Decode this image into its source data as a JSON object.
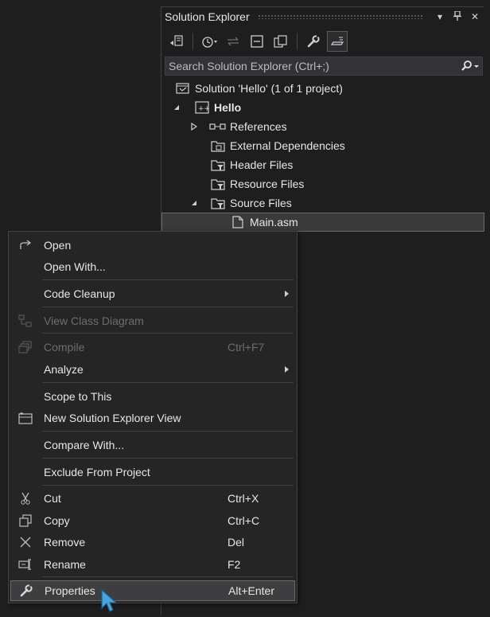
{
  "panel": {
    "title": "Solution Explorer",
    "search_placeholder": "Search Solution Explorer (Ctrl+;)"
  },
  "tree": [
    {
      "label": "Solution 'Hello' (1 of 1 project)"
    },
    {
      "label": "Hello"
    },
    {
      "label": "References"
    },
    {
      "label": "External Dependencies"
    },
    {
      "label": "Header Files"
    },
    {
      "label": "Resource Files"
    },
    {
      "label": "Source Files"
    },
    {
      "label": "Main.asm"
    }
  ],
  "menu": [
    {
      "label": "Open",
      "shortcut": "",
      "icon": "open-icon"
    },
    {
      "label": "Open With...",
      "shortcut": ""
    },
    {
      "label": "Code Cleanup",
      "shortcut": "",
      "submenu": true
    },
    {
      "label": "View Class Diagram",
      "shortcut": "",
      "disabled": true,
      "icon": "class-diagram-icon"
    },
    {
      "label": "Compile",
      "shortcut": "Ctrl+F7",
      "disabled": true,
      "icon": "compile-icon"
    },
    {
      "label": "Analyze",
      "shortcut": "",
      "submenu": true
    },
    {
      "label": "Scope to This",
      "shortcut": ""
    },
    {
      "label": "New Solution Explorer View",
      "shortcut": "",
      "icon": "new-view-icon"
    },
    {
      "label": "Compare With...",
      "shortcut": ""
    },
    {
      "label": "Exclude From Project",
      "shortcut": ""
    },
    {
      "label": "Cut",
      "shortcut": "Ctrl+X",
      "icon": "cut-icon"
    },
    {
      "label": "Copy",
      "shortcut": "Ctrl+C",
      "icon": "copy-icon"
    },
    {
      "label": "Remove",
      "shortcut": "Del",
      "icon": "remove-icon"
    },
    {
      "label": "Rename",
      "shortcut": "F2",
      "icon": "rename-icon"
    },
    {
      "label": "Properties",
      "shortcut": "Alt+Enter",
      "icon": "wrench-icon"
    }
  ],
  "colors": {
    "background": "#1f1f1f",
    "menu_bg": "#252526",
    "highlight": "#3e3e40",
    "cursor": "#4aa3df"
  }
}
